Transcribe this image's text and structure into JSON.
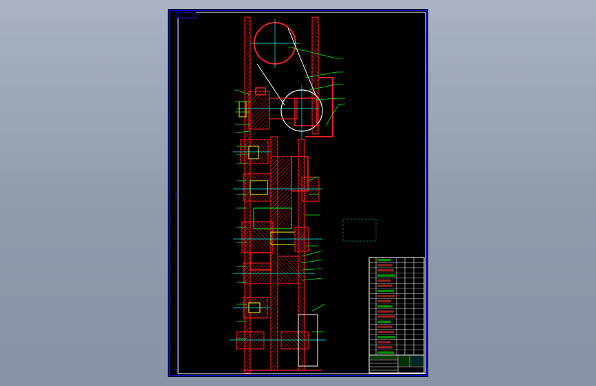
{
  "drawing": {
    "title_tab": "",
    "notes": {
      "heading": "",
      "lines": [
        "",
        ""
      ]
    },
    "parts_list_rows": 19,
    "title_block": {
      "rows": 5
    }
  },
  "colors": {
    "background": "#8f9aab",
    "paper": "#000000",
    "frame": "#1010ff",
    "inner_frame": "#ffffff",
    "section": "#ff2020",
    "leader": "#00ff00",
    "centerline": "#00ffff",
    "text": "#ffff00"
  }
}
